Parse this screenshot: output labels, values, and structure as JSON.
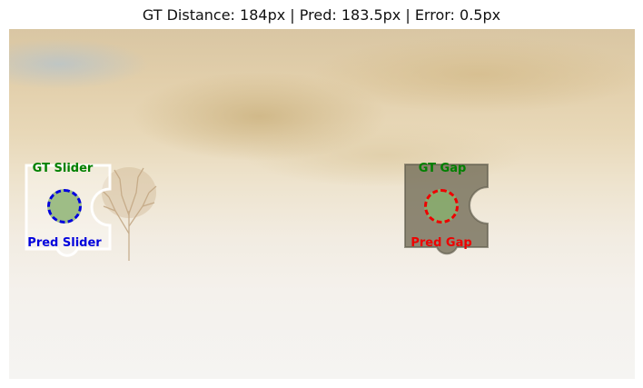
{
  "title": "GT Distance: 184px | Pred: 183.5px | Error: 0.5px",
  "slider": {
    "gt_label": "GT Slider",
    "pred_label": "Pred Slider",
    "gt_color": "#008000",
    "pred_color": "#0000dd"
  },
  "gap": {
    "gt_label": "GT Gap",
    "pred_label": "Pred Gap",
    "gt_color": "#008000",
    "pred_color": "#ee0000"
  },
  "marker_fill": "#88b06e"
}
